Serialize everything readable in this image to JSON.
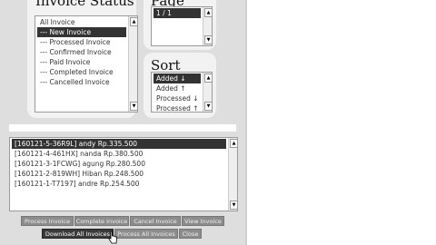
{
  "invoice_status": {
    "title": "Invoice Status",
    "items": [
      {
        "label": "All Invoice",
        "selected": false
      },
      {
        "label": "--- New Invoice",
        "selected": true
      },
      {
        "label": "--- Processed Invoice",
        "selected": false
      },
      {
        "label": "--- Confirmed Invoice",
        "selected": false
      },
      {
        "label": "--- Paid Invoice",
        "selected": false
      },
      {
        "label": "--- Completed Invoice",
        "selected": false
      },
      {
        "label": "--- Cancelled Invoice",
        "selected": false
      }
    ]
  },
  "page": {
    "title": "Page",
    "items": [
      {
        "label": "1 / 1",
        "selected": true
      }
    ]
  },
  "sort": {
    "title": "Sort",
    "items": [
      {
        "label": "Added ↓",
        "selected": true
      },
      {
        "label": "Added ↑",
        "selected": false
      },
      {
        "label": "Processed ↓",
        "selected": false
      },
      {
        "label": "Processed ↑",
        "selected": false
      }
    ]
  },
  "invoices": {
    "items": [
      {
        "label": "[160121-5-36R9L] andy Rp.335.500",
        "selected": true
      },
      {
        "label": "[160121-4-461HX] nanda Rp.380.500",
        "selected": false
      },
      {
        "label": "[160121-3-1FCWG] agung Rp.280.500",
        "selected": false
      },
      {
        "label": "[160121-2-819WH] Hiban Rp.248.500",
        "selected": false
      },
      {
        "label": "[160121-1-T7197] andre Rp.254.500",
        "selected": false
      }
    ]
  },
  "buttons": {
    "process_invoice": "Process Invoice",
    "complete_invoice": "Complete Invoice",
    "cancel_invoice": "Cancel Invoice",
    "view_invoice": "View Invoice",
    "download_all": "Download All Invoices",
    "process_all": "Process All Invoices",
    "close": "Close"
  },
  "icons": {
    "scroll_up": "▲",
    "scroll_down": "▼",
    "cursor": "hand-pointer-icon"
  }
}
